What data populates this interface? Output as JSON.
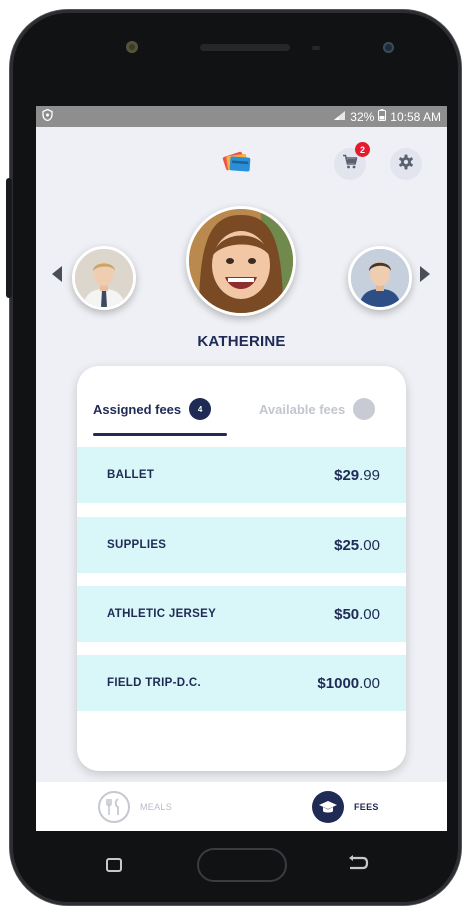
{
  "status_bar": {
    "battery": "32%",
    "time": "10:58 AM",
    "left_icon": "shield-icon",
    "signal_icon": "signal-icon",
    "battery_icon": "battery-icon"
  },
  "header": {
    "logo_icon": "cards-logo-icon",
    "cart_icon": "cart-icon",
    "cart_badge": "2",
    "settings_icon": "gear-icon"
  },
  "student_selector": {
    "selected_name": "KATHERINE",
    "prev_icon": "chevron-left-icon",
    "next_icon": "chevron-right-icon"
  },
  "tabs": [
    {
      "label": "Assigned fees",
      "count": "4",
      "active": true
    },
    {
      "label": "Available fees",
      "count": "",
      "active": false
    }
  ],
  "fees": [
    {
      "name": "BALLET",
      "dollars": "$29",
      "cents": ".99"
    },
    {
      "name": "SUPPLIES",
      "dollars": "$25",
      "cents": ".00"
    },
    {
      "name": "ATHLETIC JERSEY",
      "dollars": "$50",
      "cents": ".00"
    },
    {
      "name": "FIELD TRIP-D.C.",
      "dollars": "$1000",
      "cents": ".00"
    }
  ],
  "bottom_nav": [
    {
      "label": "MEALS",
      "icon": "meals-icon",
      "active": false
    },
    {
      "label": "FEES",
      "icon": "graduation-cap-icon",
      "active": true
    }
  ],
  "colors": {
    "primary": "#1f2a55",
    "row_bg": "#d9f6f9",
    "badge": "#e8192c",
    "screen_bg": "#eef0f5"
  }
}
